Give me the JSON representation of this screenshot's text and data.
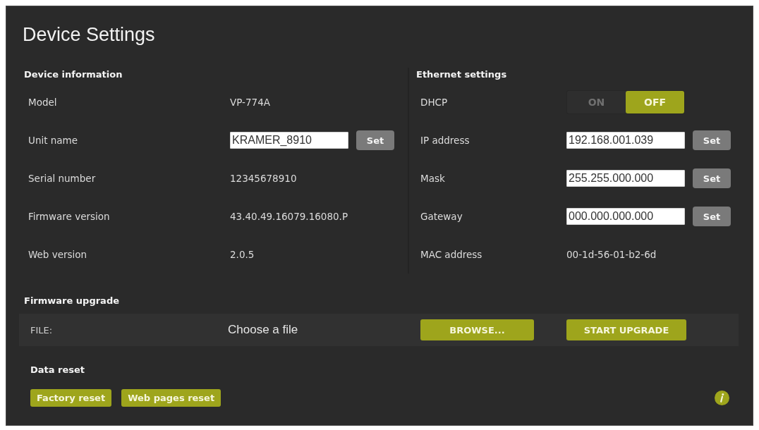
{
  "title": "Device Settings",
  "device_information": {
    "heading": "Device information",
    "rows": [
      {
        "kind": "text",
        "label": "Model",
        "value": "VP-774A"
      },
      {
        "kind": "input",
        "label": "Unit name",
        "value": "KRAMER_8910",
        "button": "Set"
      },
      {
        "kind": "text",
        "label": "Serial number",
        "value": "12345678910"
      },
      {
        "kind": "text",
        "label": "Firmware version",
        "value": "43.40.49.16079.16080.P"
      },
      {
        "kind": "text",
        "label": "Web version",
        "value": "2.0.5"
      }
    ]
  },
  "ethernet_settings": {
    "heading": "Ethernet settings",
    "rows": [
      {
        "kind": "toggle",
        "label": "DHCP",
        "options": [
          {
            "label": "ON",
            "selected": false
          },
          {
            "label": "OFF",
            "selected": true
          }
        ]
      },
      {
        "kind": "input",
        "label": "IP address",
        "value": "192.168.001.039",
        "button": "Set"
      },
      {
        "kind": "input",
        "label": "Mask",
        "value": "255.255.000.000",
        "button": "Set"
      },
      {
        "kind": "input",
        "label": "Gateway",
        "value": "000.000.000.000",
        "button": "Set"
      },
      {
        "kind": "text",
        "label": "MAC address",
        "value": "00-1d-56-01-b2-6d"
      }
    ]
  },
  "firmware_upgrade": {
    "heading": "Firmware upgrade",
    "file_label": "FILE:",
    "file_prompt": "Choose a file",
    "buttons": [
      "BROWSE...",
      "START UPGRADE"
    ]
  },
  "data_reset": {
    "heading": "Data reset",
    "buttons": [
      "Factory reset",
      "Web pages reset"
    ]
  }
}
